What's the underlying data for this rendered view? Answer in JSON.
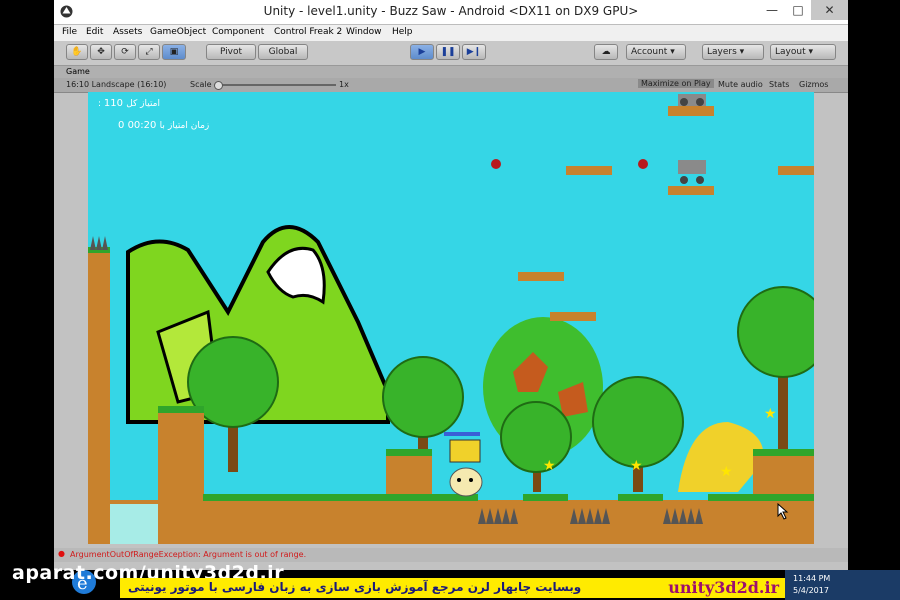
{
  "window": {
    "title": "Unity - level1.unity - Buzz Saw - Android <DX11 on DX9 GPU>",
    "minimize_glyph": "—",
    "maximize_glyph": "□",
    "close_glyph": "✕"
  },
  "menu": {
    "items": [
      "File",
      "Edit",
      "Assets",
      "GameObject",
      "Component",
      "Control Freak 2",
      "Window",
      "Help"
    ]
  },
  "toolbar": {
    "pivot": "Pivot",
    "global": "Global",
    "account": "Account",
    "layers": "Layers",
    "layout": "Layout"
  },
  "game_panel": {
    "tab": "Game",
    "aspect": "16:10 Landscape (16:10)",
    "scale_label": "Scale",
    "scale_value": "1x",
    "maximize_on_play": "Maximize on Play",
    "mute_audio": "Mute audio",
    "stats": "Stats",
    "gizmos": "Gizmos"
  },
  "hud": {
    "score_value": "110",
    "score_label": ": امتیاز کل",
    "time_score": "0",
    "time_value": "00:20",
    "time_prefix": "با",
    "time_label": "زمان امتیاز"
  },
  "status": {
    "error": "ArgumentOutOfRangeException: Argument is out of range."
  },
  "overlay": {
    "watermark": "aparat.com/unity3d2d.ir",
    "banner_fa": "وبسایت چابهار لرن مرجع آموزش بازی سازی به زبان فارسی با موتور یونیتی",
    "banner_site": "unity3d2d.ir"
  },
  "taskbar": {
    "time": "11:44 PM",
    "date": "5/4/2017"
  },
  "colors": {
    "sky": "#35d6e6",
    "mountain": "#7fd61f",
    "grass": "#2fa52b",
    "dirt": "#c8822d",
    "banner": "#ffeb00",
    "site_text": "#9c0f6e"
  }
}
